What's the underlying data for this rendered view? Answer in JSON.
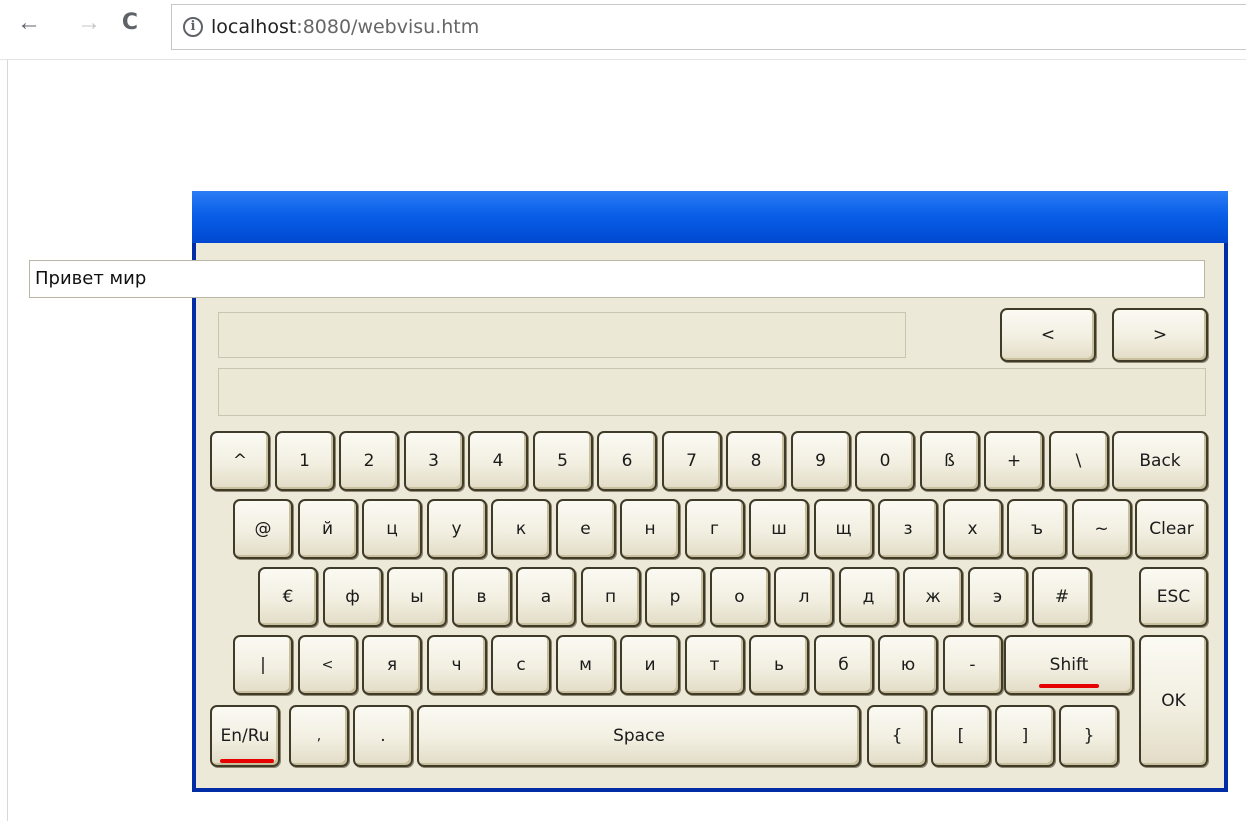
{
  "browser": {
    "back_icon": "←",
    "forward_icon": "→",
    "reload_icon": "C",
    "info_icon": "i",
    "url_host": "localhost",
    "url_rest": ":8080/webvisu.htm"
  },
  "keyboard": {
    "input_value": "Привет мир",
    "nav_left": "<",
    "nav_right": ">",
    "rows": [
      [
        "^",
        "1",
        "2",
        "3",
        "4",
        "5",
        "6",
        "7",
        "8",
        "9",
        "0",
        "ß",
        "+",
        "\\",
        "Back"
      ],
      [
        "@",
        "й",
        "ц",
        "у",
        "к",
        "е",
        "н",
        "г",
        "ш",
        "щ",
        "з",
        "х",
        "ъ",
        "~",
        "Clear"
      ],
      [
        "€",
        "ф",
        "ы",
        "в",
        "а",
        "п",
        "р",
        "о",
        "л",
        "д",
        "ж",
        "э",
        "#",
        "ESC"
      ],
      [
        "|",
        "<",
        "я",
        "ч",
        "с",
        "м",
        "и",
        "т",
        "ь",
        "б",
        "ю",
        "-",
        "Shift"
      ],
      [
        "En/Ru",
        ",",
        ".",
        "Space",
        "{",
        "[",
        "]",
        "}",
        "OK"
      ]
    ]
  }
}
